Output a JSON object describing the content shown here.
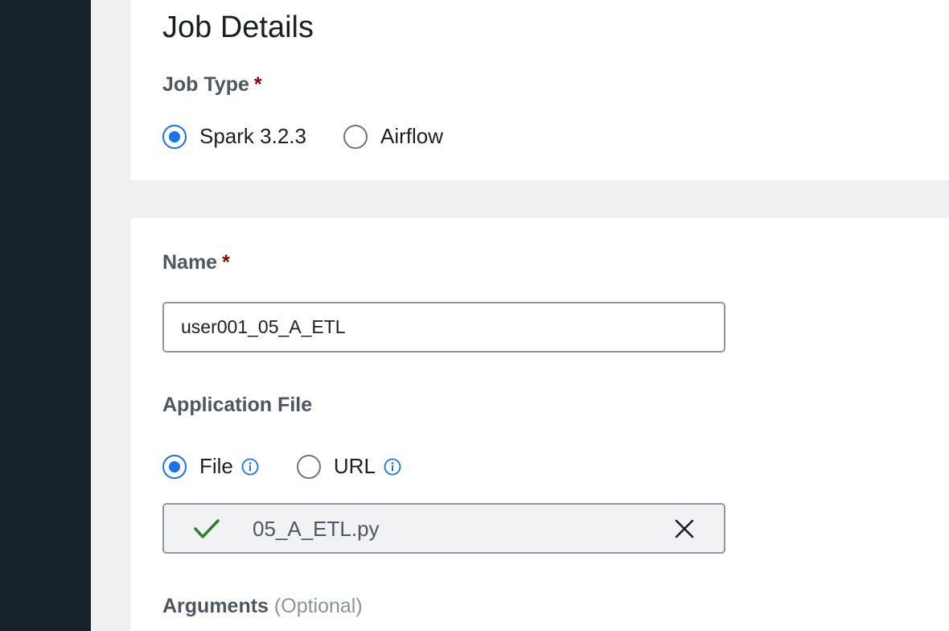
{
  "section": {
    "title": "Job Details"
  },
  "job_type": {
    "label": "Job Type",
    "required_mark": "*",
    "options": [
      {
        "label": "Spark 3.2.3",
        "selected": true
      },
      {
        "label": "Airflow",
        "selected": false
      }
    ]
  },
  "name_field": {
    "label": "Name",
    "required_mark": "*",
    "value": "user001_05_A_ETL"
  },
  "application_file": {
    "label": "Application File",
    "options": [
      {
        "label": "File",
        "selected": true,
        "icon": "info-icon"
      },
      {
        "label": "URL",
        "selected": false,
        "icon": "info-icon"
      }
    ],
    "uploaded_file": {
      "name": "05_A_ETL.py",
      "status_icon": "checkmark-icon",
      "remove_icon": "close-icon"
    }
  },
  "arguments": {
    "label": "Arguments",
    "optional": "(Optional)"
  },
  "colors": {
    "accent": "#1a73e8",
    "success": "#2e7d32",
    "required": "#8b0000",
    "sidebar": "#18222b"
  }
}
